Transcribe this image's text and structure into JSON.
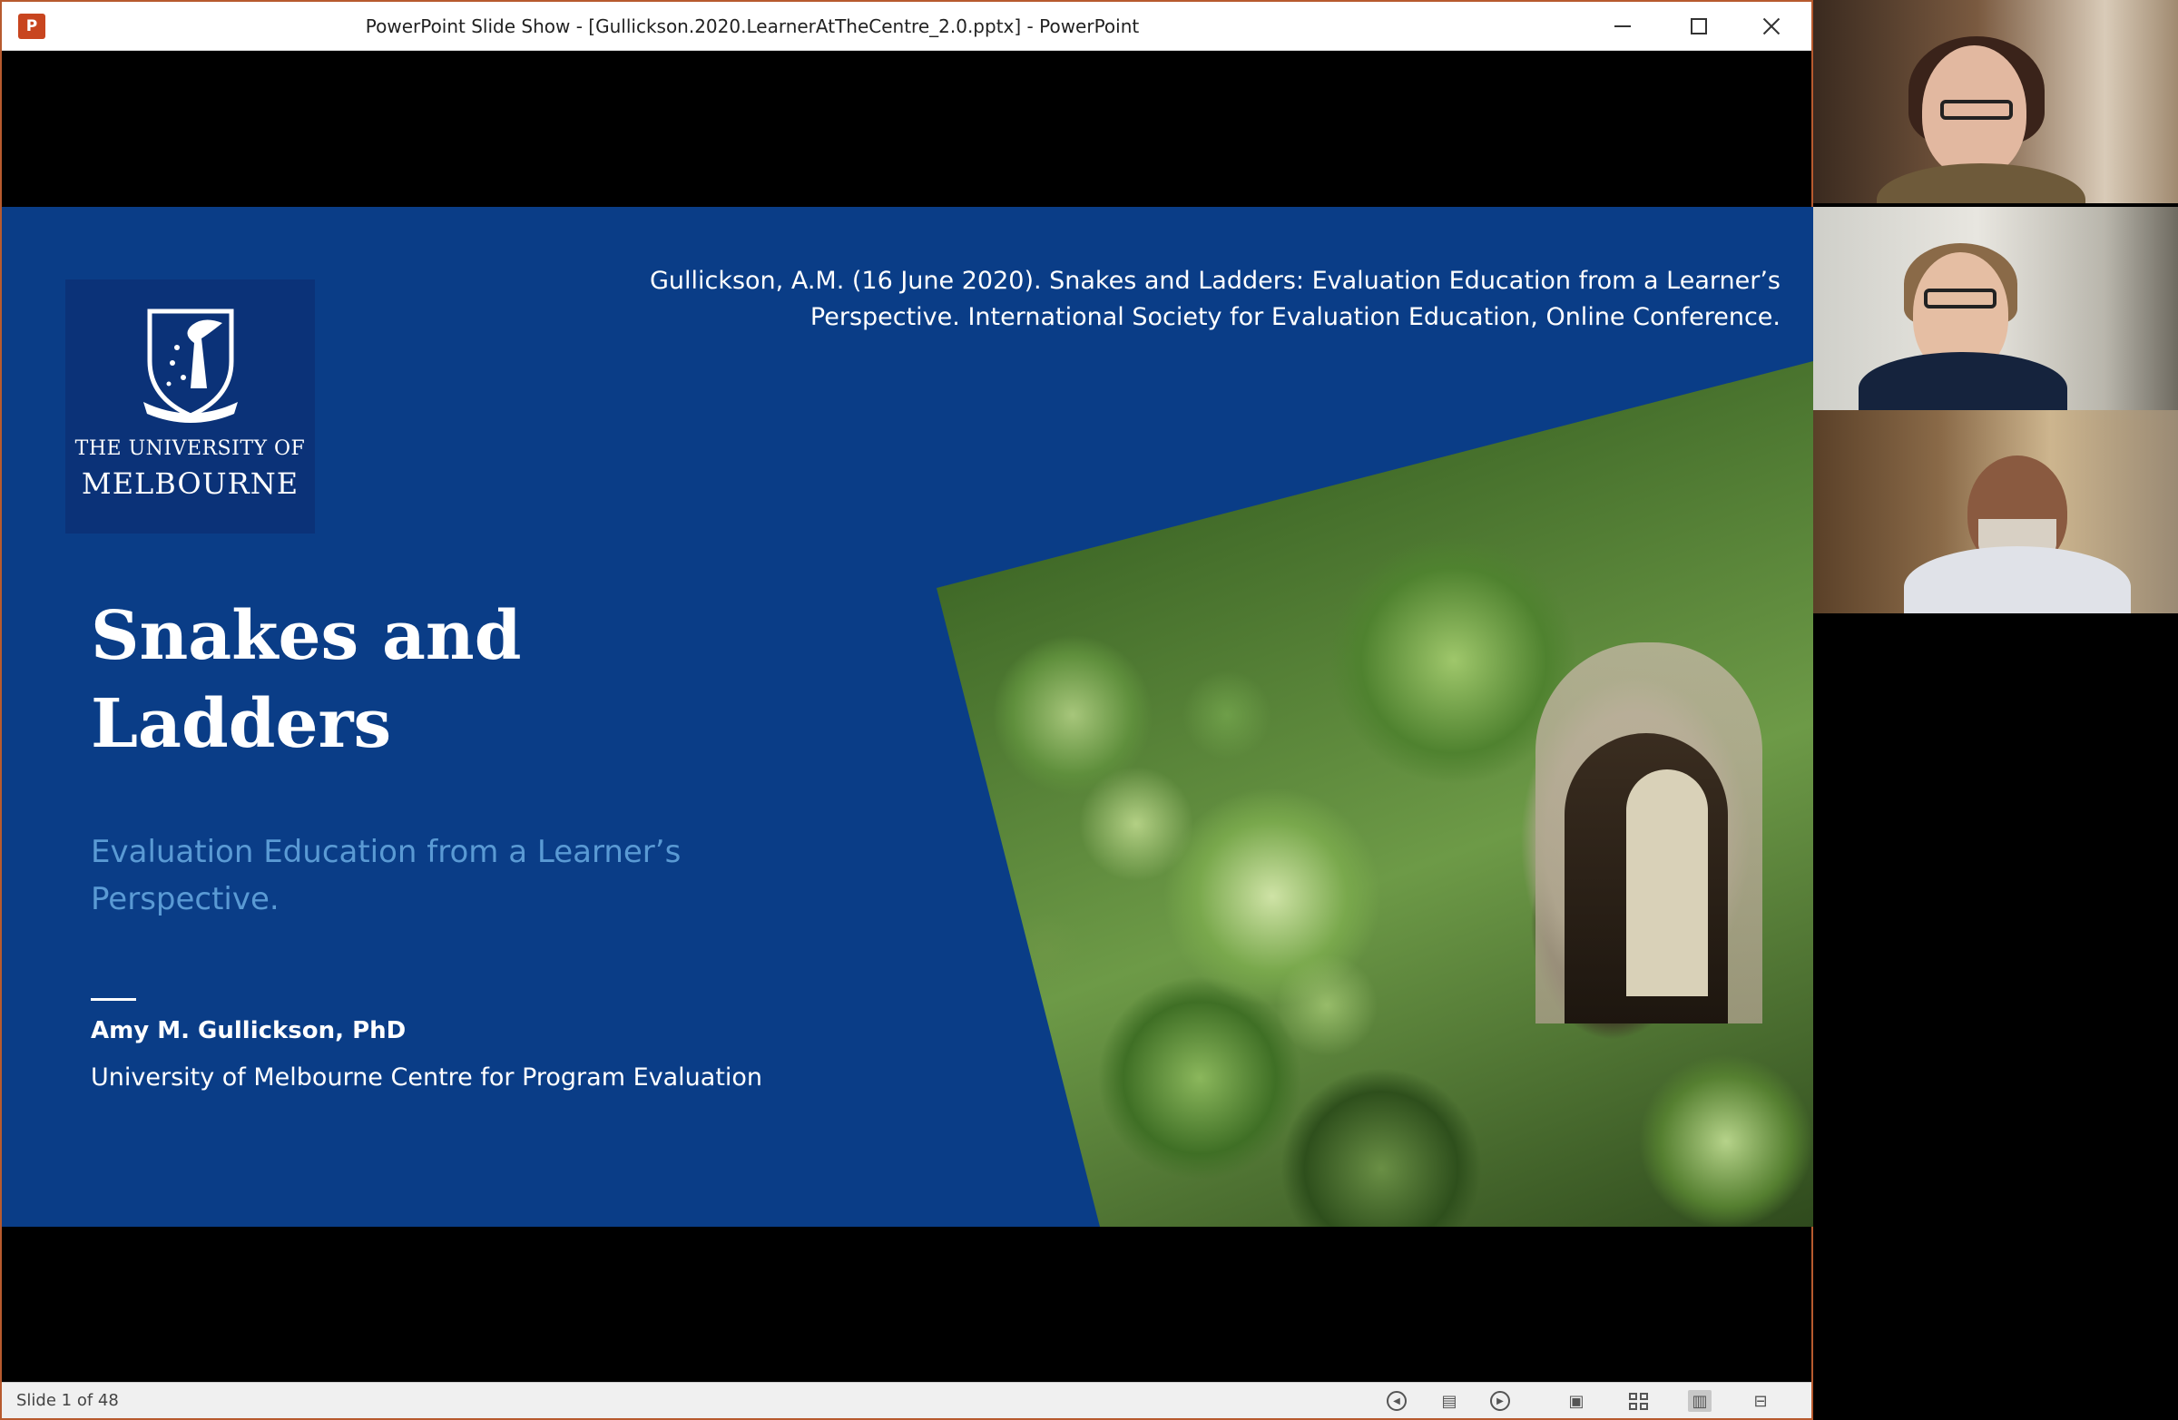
{
  "window": {
    "app_icon": "P",
    "title": "PowerPoint Slide Show - [Gullickson.2020.LearnerAtTheCentre_2.0.pptx] - PowerPoint"
  },
  "slide": {
    "logo_line1": "THE UNIVERSITY OF",
    "logo_line2": "MELBOURNE",
    "citation_line1": "Gullickson, A.M. (16 June 2020). Snakes and Ladders: Evaluation Education from a Learner’s",
    "citation_line2": "Perspective. International Society for Evaluation Education, Online Conference.",
    "title_line1": "Snakes and",
    "title_line2": "Ladders",
    "subtitle_line1": "Evaluation Education from a Learner’s",
    "subtitle_line2": "Perspective.",
    "author": "Amy M. Gullickson, PhD",
    "affiliation": "University of Melbourne Centre for Program Evaluation"
  },
  "statusbar": {
    "slide_count": "Slide 1 of 48"
  },
  "icons": {
    "app": "powerpoint-icon",
    "minimize": "minimize-icon",
    "maximize": "maximize-icon",
    "close": "close-icon",
    "prev": "previous-slide-icon",
    "menu": "slide-menu-icon",
    "next": "next-slide-icon",
    "normal": "normal-view-icon",
    "sorter": "slide-sorter-icon",
    "reading": "reading-view-icon",
    "slideshow": "slide-show-icon"
  },
  "colors": {
    "slide_background": "#0a3d87",
    "subtitle": "#5a9ad4",
    "window_border": "#b75a2e"
  }
}
